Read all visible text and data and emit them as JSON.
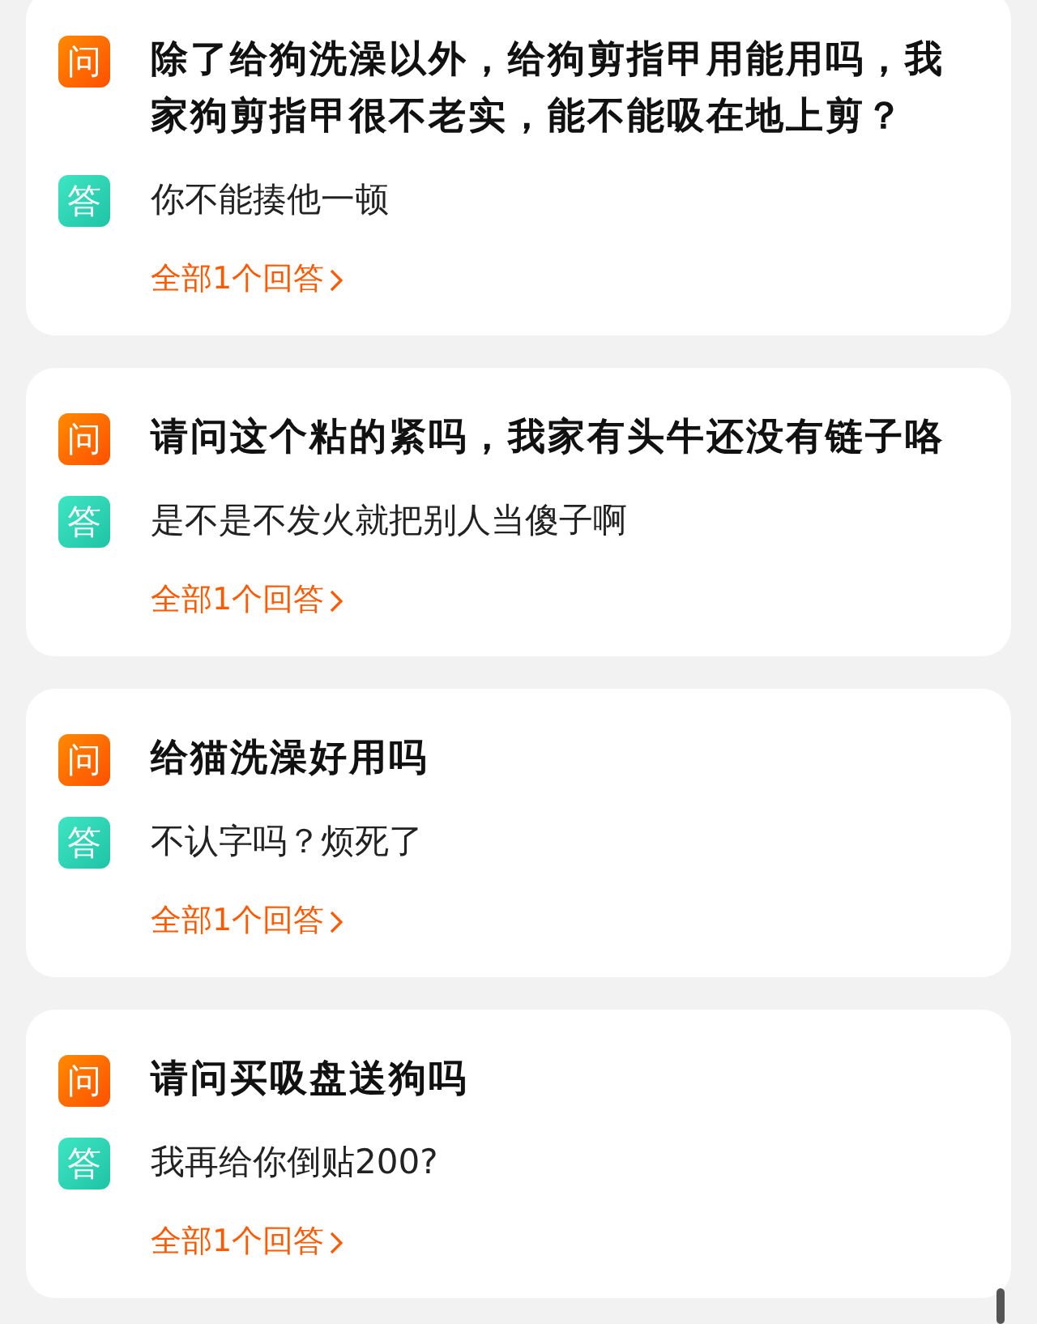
{
  "questions": [
    {
      "question": "除了给狗洗澡以外，给狗剪指甲用能用吗，我家狗剪指甲很不老实，能不能吸在地上剪？",
      "q_badge": "问",
      "answer": "你不能揍他一顿",
      "a_badge": "答",
      "link": "全部1个回答"
    },
    {
      "question": "请问这个粘的紧吗，我家有头牛还没有链子咯",
      "q_badge": "问",
      "answer": "是不是不发火就把别人当傻子啊",
      "a_badge": "答",
      "link": "全部1个回答"
    },
    {
      "question": "给猫洗澡好用吗",
      "q_badge": "问",
      "answer": "不认字吗？烦死了",
      "a_badge": "答",
      "link": "全部1个回答"
    },
    {
      "question": "请问买吸盘送狗吗",
      "q_badge": "问",
      "answer": "我再给你倒贴200?",
      "a_badge": "答",
      "link": "全部1个回答"
    }
  ]
}
